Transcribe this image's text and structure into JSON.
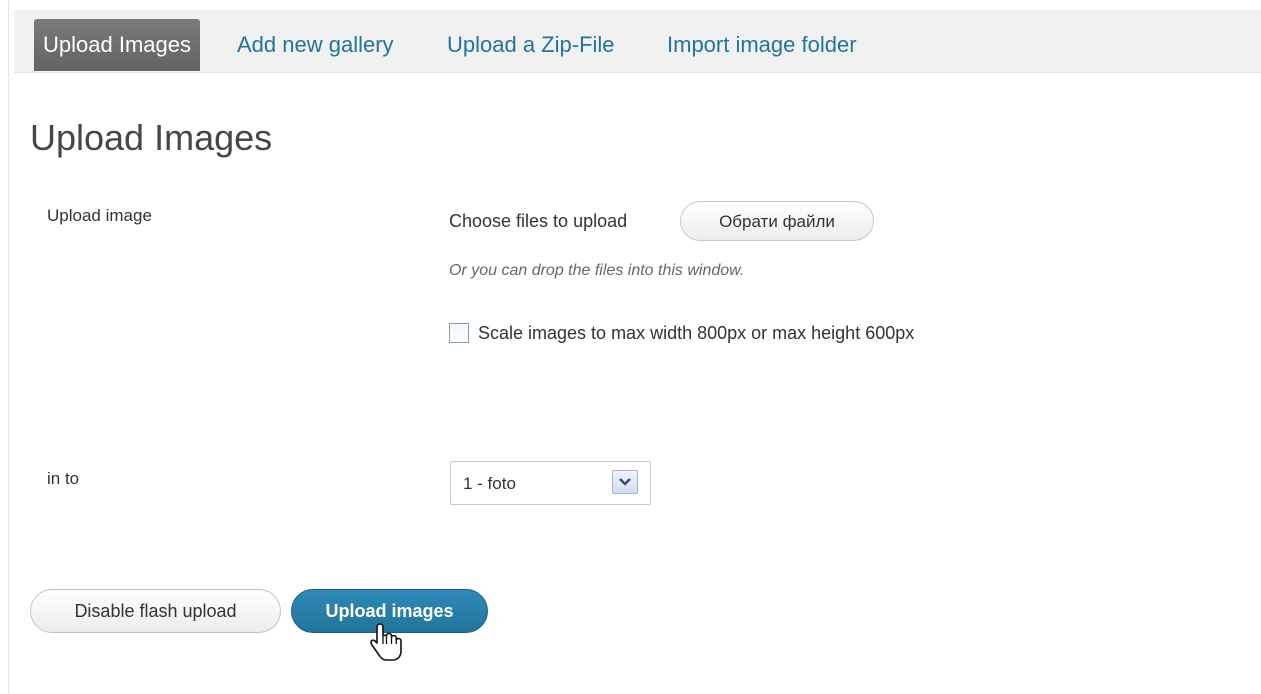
{
  "tabs": [
    {
      "label": "Upload Images",
      "active": true
    },
    {
      "label": "Add new gallery",
      "active": false
    },
    {
      "label": "Upload a Zip-File",
      "active": false
    },
    {
      "label": "Import image folder",
      "active": false
    }
  ],
  "page": {
    "title": "Upload Images"
  },
  "form": {
    "upload_label": "Upload image",
    "choose_text": "Choose files to upload",
    "browse_button": "Обрати файли",
    "drop_hint": "Or you can drop the files into this window.",
    "scale_checkbox_label": "Scale images to max width 800px or max height 600px",
    "scale_checked": false,
    "into_label": "in to",
    "gallery_select_value": "1 - foto"
  },
  "buttons": {
    "disable_flash": "Disable flash upload",
    "upload_images": "Upload images"
  },
  "colors": {
    "link": "#21759b",
    "primary_button": "#21759b",
    "active_tab": "#6d6d6d"
  },
  "icons": {
    "select_arrow": "chevron-down-icon",
    "cursor": "hand-pointer-icon"
  }
}
